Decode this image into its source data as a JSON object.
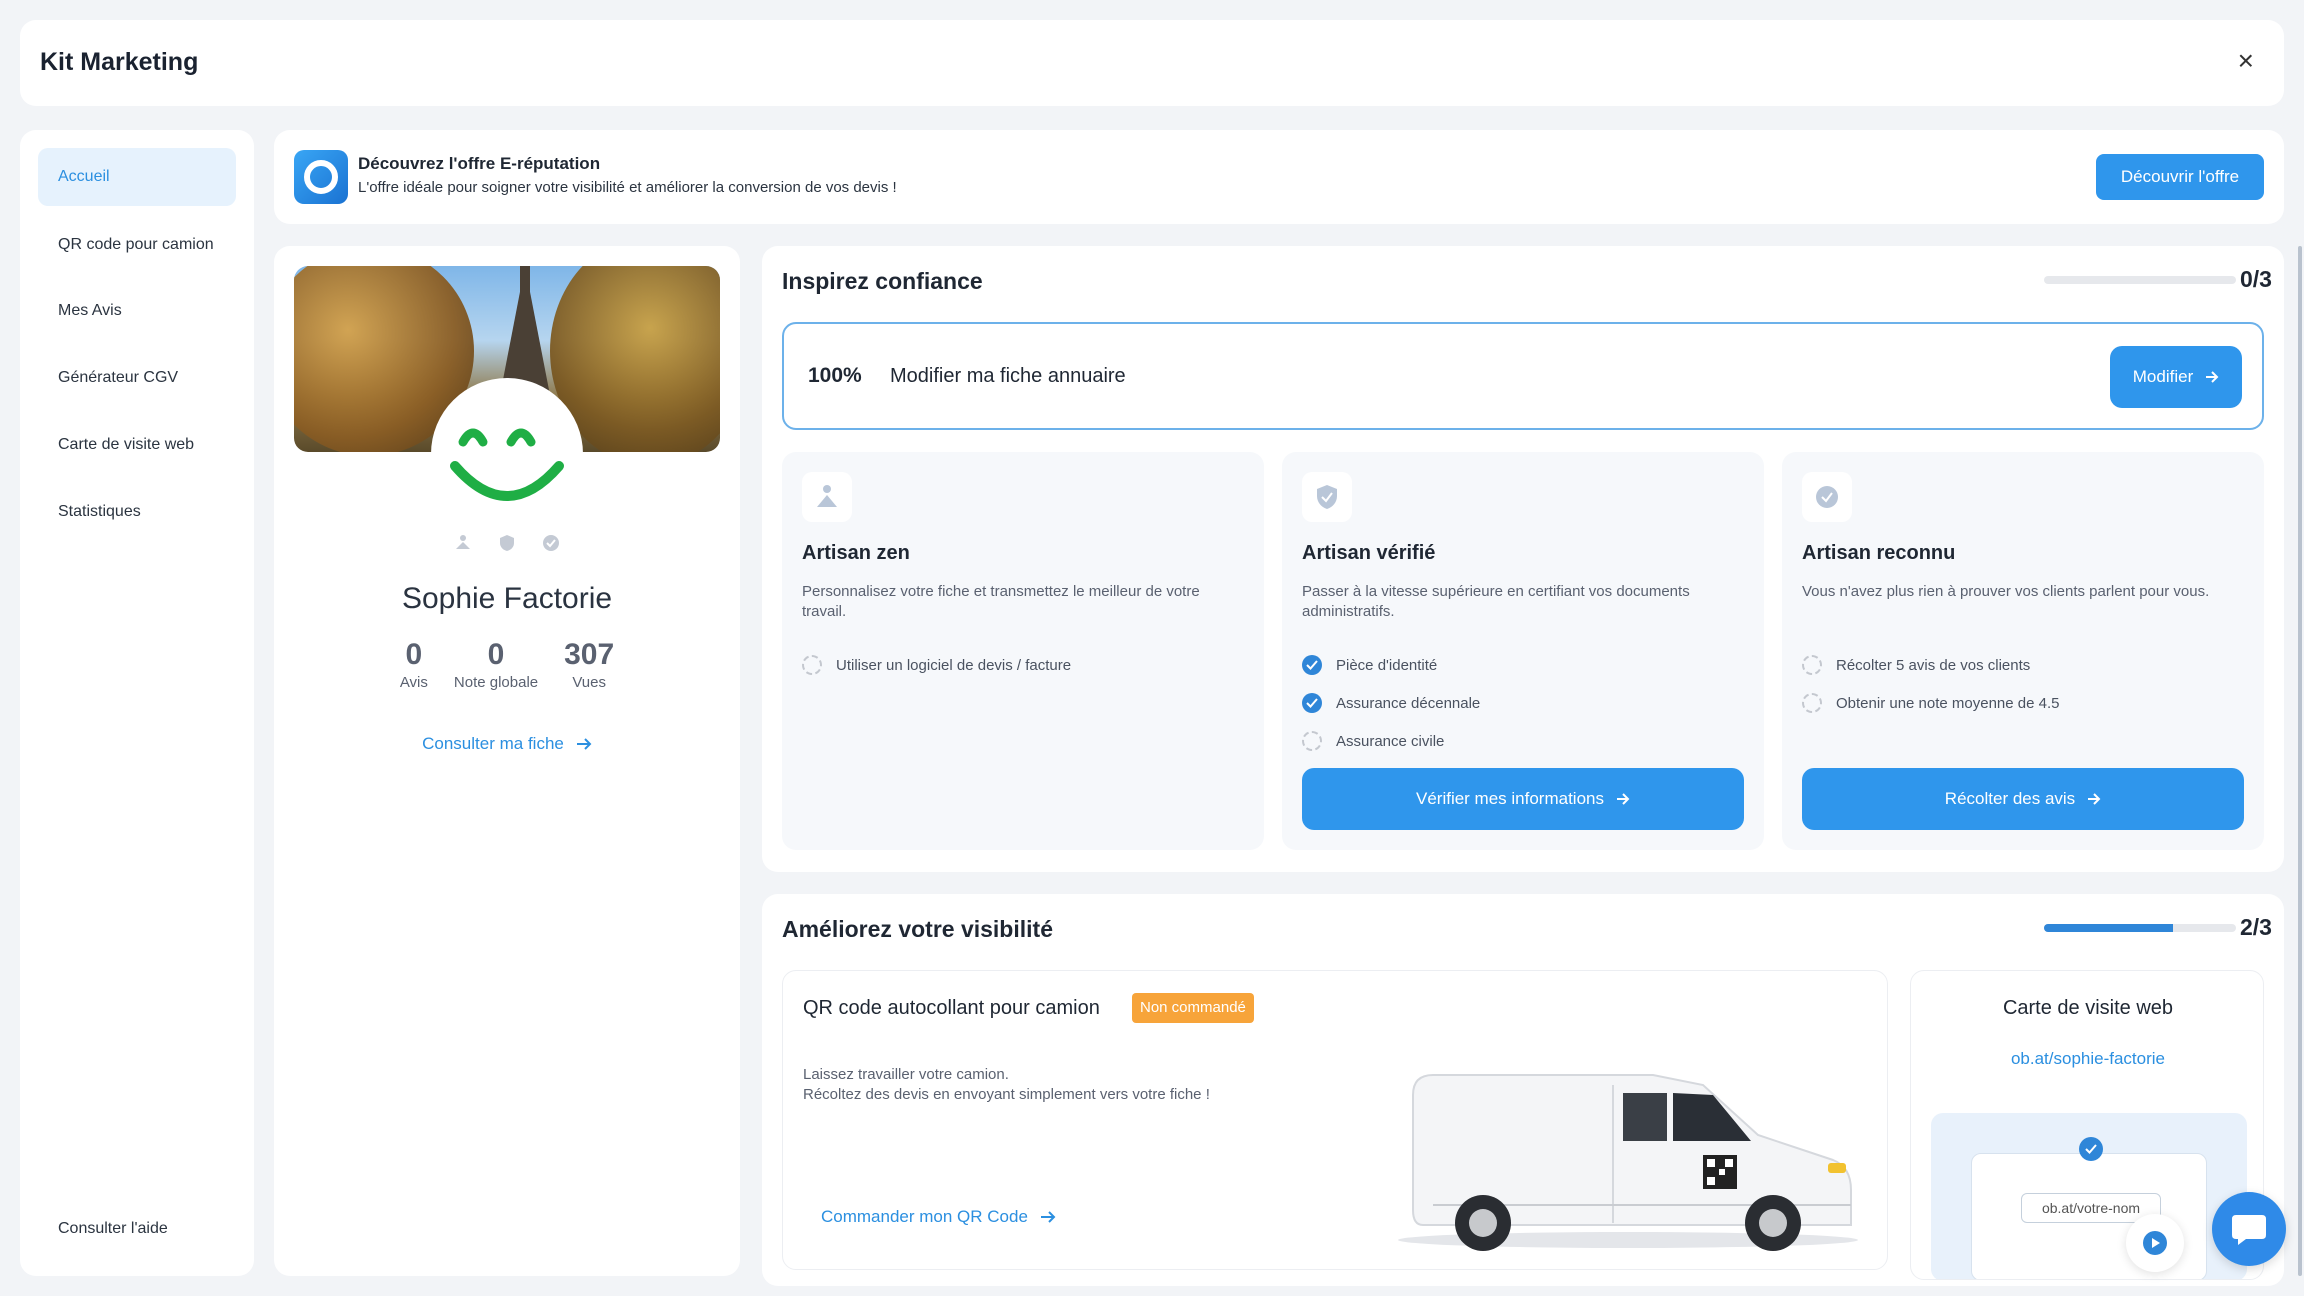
{
  "header": {
    "title": "Kit Marketing",
    "close": "×"
  },
  "sidebar": {
    "items": [
      {
        "label": "Accueil",
        "active": true
      },
      {
        "label": "QR code pour camion"
      },
      {
        "label": "Mes Avis"
      },
      {
        "label": "Générateur CGV"
      },
      {
        "label": "Carte de visite web"
      },
      {
        "label": "Statistiques"
      }
    ],
    "help": "Consulter l'aide"
  },
  "banner": {
    "title": "Découvrez l'offre E-réputation",
    "subtitle": "L'offre idéale pour soigner votre visibilité et améliorer la conversion de vos devis !",
    "button": "Découvrir l'offre"
  },
  "profile": {
    "name": "Sophie Factorie",
    "stats": [
      {
        "value": "0",
        "label": "Avis"
      },
      {
        "value": "0",
        "label": "Note globale"
      },
      {
        "value": "307",
        "label": "Vues"
      }
    ],
    "link": "Consulter ma fiche"
  },
  "trust": {
    "title": "Inspirez confiance",
    "progress_text": "0/3",
    "progress": 0,
    "fiche": {
      "percent": "100%",
      "label": "Modifier ma fiche annuaire",
      "button": "Modifier"
    },
    "cards": [
      {
        "icon": "meditation-icon",
        "title": "Artisan zen",
        "desc": "Personnalisez votre fiche et transmettez le meilleur de votre travail.",
        "checks": [
          {
            "label": "Utiliser un logiciel de devis / facture",
            "done": false
          }
        ]
      },
      {
        "icon": "shield-check-icon",
        "title": "Artisan vérifié",
        "desc": "Passer à la vitesse supérieure en certifiant vos documents administratifs.",
        "checks": [
          {
            "label": "Pièce d'identité",
            "done": true
          },
          {
            "label": "Assurance décennale",
            "done": true
          },
          {
            "label": "Assurance civile",
            "done": false
          }
        ],
        "button": "Vérifier mes informations"
      },
      {
        "icon": "badge-check-icon",
        "title": "Artisan reconnu",
        "desc": "Vous n'avez plus rien à prouver vos clients parlent pour vous.",
        "checks": [
          {
            "label": "Récolter 5 avis de vos clients",
            "done": false
          },
          {
            "label": "Obtenir une note moyenne de 4.5",
            "done": false
          }
        ],
        "button": "Récolter des avis"
      }
    ]
  },
  "visibility": {
    "title": "Améliorez votre visibilité",
    "progress_text": "2/3",
    "progress": 0.67,
    "qr": {
      "title": "QR code autocollant pour camion",
      "badge": "Non commandé",
      "desc_line1": "Laissez travailler votre camion.",
      "desc_line2": "Récoltez des devis en envoyant simplement vers votre fiche !",
      "link": "Commander mon QR Code"
    },
    "card": {
      "title": "Carte de visite web",
      "link": "ob.at/sophie-factorie",
      "field": "ob.at/votre-nom"
    }
  },
  "colors": {
    "accent": "#2f96ec",
    "badge": "#f7a43a",
    "smile": "#1fae45"
  }
}
